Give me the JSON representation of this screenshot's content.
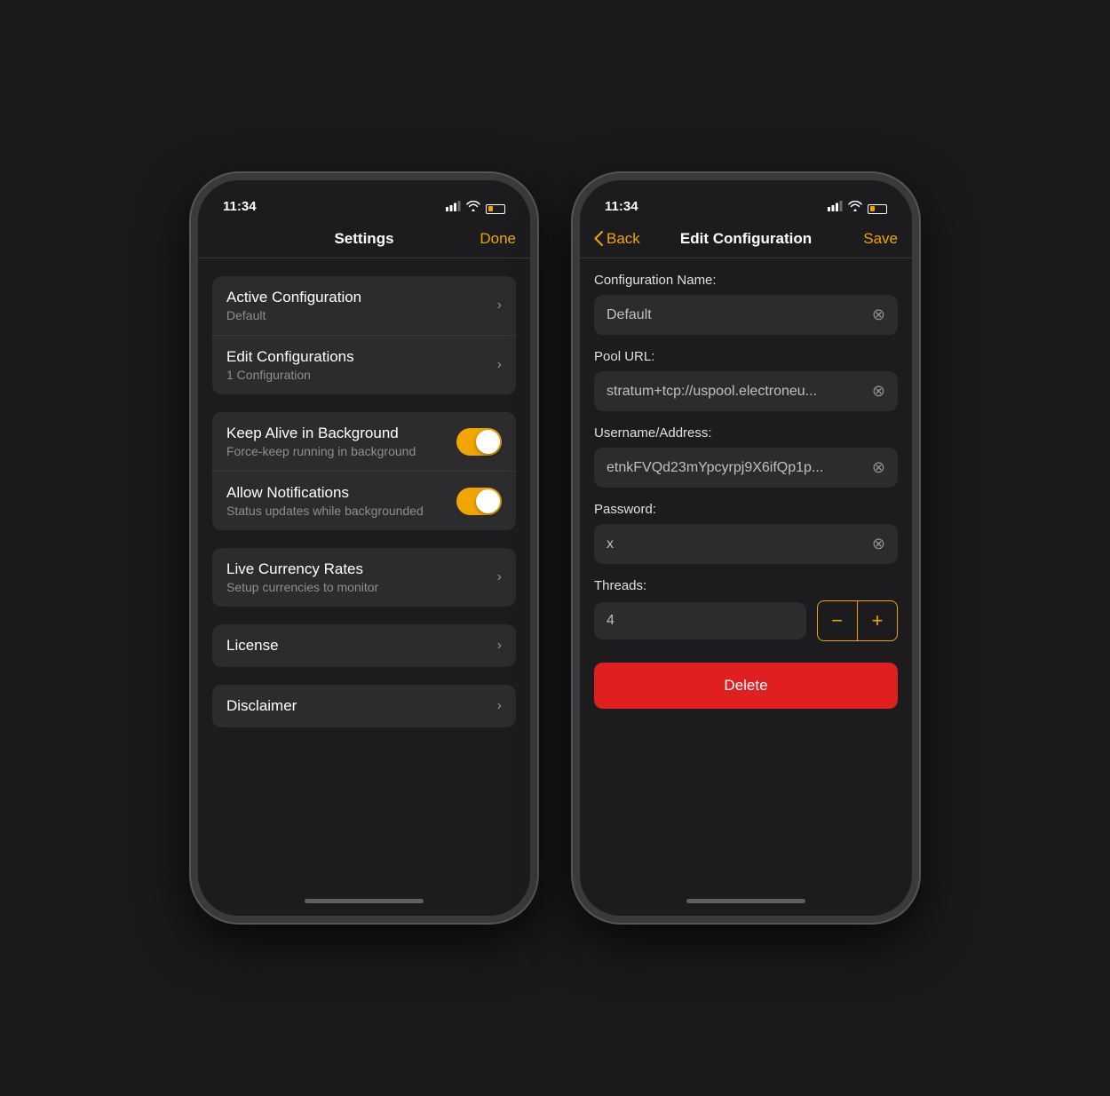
{
  "phone1": {
    "status": {
      "time": "11:34",
      "signal": "▲▲▲",
      "wifi": "wifi",
      "battery": "batt"
    },
    "nav": {
      "title": "Settings",
      "done_label": "Done"
    },
    "sections": [
      {
        "rows": [
          {
            "title": "Active Configuration",
            "subtitle": "Default",
            "has_chevron": true
          },
          {
            "title": "Edit Configurations",
            "subtitle": "1 Configuration",
            "has_chevron": true
          }
        ]
      },
      {
        "rows": [
          {
            "title": "Keep Alive in Background",
            "subtitle": "Force-keep running in background",
            "has_toggle": true
          },
          {
            "title": "Allow Notifications",
            "subtitle": "Status updates while backgrounded",
            "has_toggle": true
          }
        ]
      },
      {
        "rows": [
          {
            "title": "Live Currency Rates",
            "subtitle": "Setup currencies to monitor",
            "has_chevron": true
          }
        ]
      },
      {
        "rows": [
          {
            "title": "License",
            "subtitle": "",
            "has_chevron": true
          }
        ]
      },
      {
        "rows": [
          {
            "title": "Disclaimer",
            "subtitle": "",
            "has_chevron": true
          }
        ]
      }
    ]
  },
  "phone2": {
    "status": {
      "time": "11:34"
    },
    "nav": {
      "back_label": "Back",
      "title": "Edit Configuration",
      "save_label": "Save"
    },
    "fields": {
      "config_name_label": "Configuration Name:",
      "config_name_value": "Default",
      "pool_url_label": "Pool URL:",
      "pool_url_value": "stratum+tcp://uspool.electroneu...",
      "username_label": "Username/Address:",
      "username_value": "etnkFVQd23mYpcyrpj9X6ifQp1p...",
      "password_label": "Password:",
      "password_value": "x",
      "threads_label": "Threads:",
      "threads_value": "4",
      "decrement_label": "−",
      "increment_label": "+",
      "delete_label": "Delete"
    }
  }
}
